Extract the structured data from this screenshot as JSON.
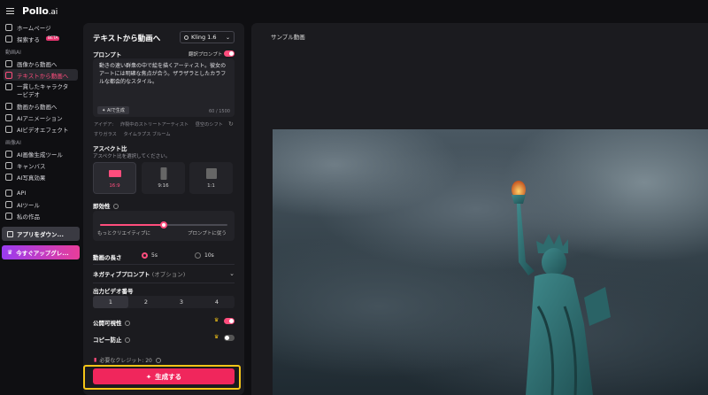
{
  "app": {
    "logo": "Pollo",
    "logo_suffix": ".ai"
  },
  "sidebar": {
    "items_top": [
      {
        "label": "ホームページ",
        "icon": "home-icon"
      },
      {
        "label": "探索する",
        "icon": "compass-icon",
        "badge": "BETA"
      }
    ],
    "section_video": "動画AI",
    "items_video": [
      {
        "label": "画像から動画へ",
        "icon": "image-video-icon"
      },
      {
        "label": "テキストから動画へ",
        "icon": "text-video-icon",
        "active": true
      },
      {
        "label": "一貫したキャラクタービデオ",
        "icon": "character-icon"
      },
      {
        "label": "動画から動画へ",
        "icon": "video-video-icon"
      },
      {
        "label": "AIアニメーション",
        "icon": "animation-icon"
      },
      {
        "label": "AIビデオエフェクト",
        "icon": "effects-icon"
      }
    ],
    "section_image": "画像AI",
    "items_image": [
      {
        "label": "AI画像生成ツール",
        "icon": "image-gen-icon"
      },
      {
        "label": "キャンバス",
        "icon": "canvas-icon"
      },
      {
        "label": "AI写真効果",
        "icon": "photo-effect-icon"
      }
    ],
    "items_bottom": [
      {
        "label": "API",
        "icon": "api-icon"
      },
      {
        "label": "AIツール",
        "icon": "tools-icon"
      },
      {
        "label": "私の作品",
        "icon": "works-icon"
      }
    ],
    "download_label": "アプリをダウン...",
    "upgrade_label": "今すぐアップグレ..."
  },
  "panel": {
    "title": "テキストから動画へ",
    "model": "Kling 1.6",
    "prompt_label": "プロンプト",
    "translate_label": "翻訳プロンプト",
    "prompt_text": "動きの速い群衆の中で絵を描くアーティスト。彼女のアートには明確な焦点が合う。ザラザラとしたカラフルな都会的なスタイル。",
    "ai_generate_label": "AIで生成",
    "char_count": "60 / 1500",
    "ideas_label": "アイデア:",
    "ideas": [
      "炸裂中のストリートアーティスト",
      "昼空のシフト",
      "すりガラス",
      "タイムラプス ブルーム"
    ],
    "aspect_label": "アスペクト比",
    "aspect_hint": "アスペクト比を選択してください。",
    "aspects": [
      {
        "label": "16:9",
        "selected": true
      },
      {
        "label": "9:16",
        "selected": false
      },
      {
        "label": "1:1",
        "selected": false
      }
    ],
    "creativity_label": "即効性",
    "creativity_left": "もっとクリエイティブに",
    "creativity_right": "プロンプトに従う",
    "creativity_value": 0.5,
    "duration_label": "動画の長さ",
    "duration_options": [
      "5s",
      "10s"
    ],
    "duration_selected": "5s",
    "negative_label": "ネガティブプロンプト",
    "negative_optional": "(オプション)",
    "output_count_label": "出力ビデオ番号",
    "output_counts": [
      "1",
      "2",
      "3",
      "4"
    ],
    "output_selected": "1",
    "public_label": "公開可視性",
    "copy_protect_label": "コピー防止",
    "credit_label": "必要なクレジット: 20",
    "generate_label": "生成する"
  },
  "sample": {
    "title": "サンプル動画"
  },
  "colors": {
    "accent": "#ff4d7d",
    "highlight": "#f5c518"
  }
}
